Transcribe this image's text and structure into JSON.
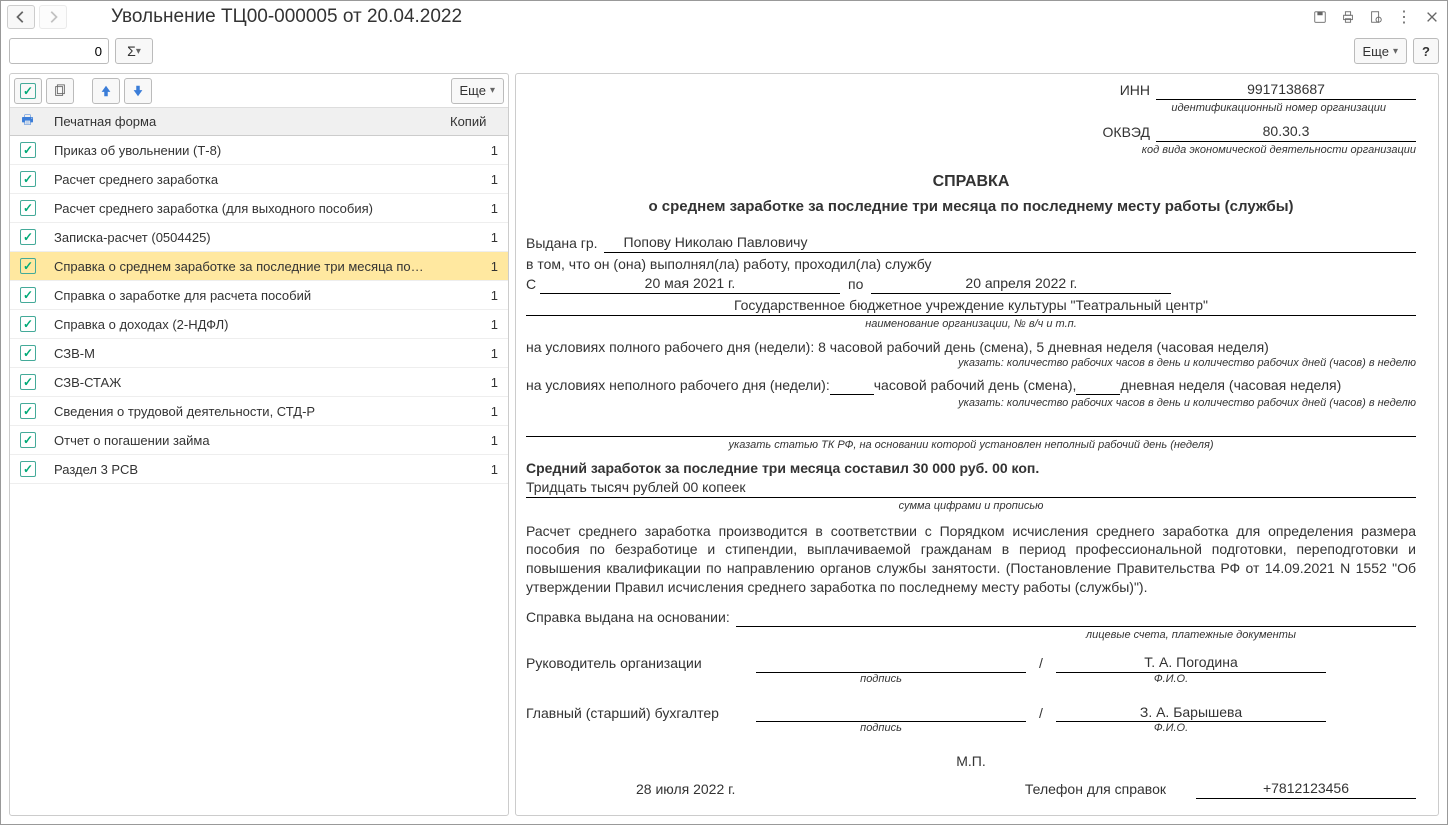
{
  "titlebar": {
    "title": "Увольнение ТЦ00-000005 от 20.04.2022"
  },
  "toolbar": {
    "num_value": "0",
    "more_label": "Еще",
    "help_label": "?"
  },
  "left_toolbar": {
    "more_label": "Еще"
  },
  "list": {
    "header_form": "Печатная форма",
    "header_copies": "Копий",
    "items": [
      {
        "label": "Приказ об увольнении (Т-8)",
        "copies": "1",
        "selected": false
      },
      {
        "label": "Расчет среднего заработка",
        "copies": "1",
        "selected": false
      },
      {
        "label": "Расчет среднего заработка (для выходного пособия)",
        "copies": "1",
        "selected": false
      },
      {
        "label": "Записка-расчет (0504425)",
        "copies": "1",
        "selected": false
      },
      {
        "label": "Справка о среднем заработке за последние три месяца по…",
        "copies": "1",
        "selected": true
      },
      {
        "label": "Справка о заработке для расчета пособий",
        "copies": "1",
        "selected": false
      },
      {
        "label": "Справка о доходах (2-НДФЛ)",
        "copies": "1",
        "selected": false
      },
      {
        "label": "СЗВ-М",
        "copies": "1",
        "selected": false
      },
      {
        "label": "СЗВ-СТАЖ",
        "copies": "1",
        "selected": false
      },
      {
        "label": "Сведения о трудовой деятельности, СТД-Р",
        "copies": "1",
        "selected": false
      },
      {
        "label": "Отчет о погашении займа",
        "copies": "1",
        "selected": false
      },
      {
        "label": "Раздел 3 РСВ",
        "copies": "1",
        "selected": false
      }
    ]
  },
  "doc": {
    "inn_label": "ИНН",
    "inn_val": "9917138687",
    "inn_sub": "идентификационный номер организации",
    "okved_label": "ОКВЭД",
    "okved_val": "80.30.3",
    "okved_sub": "код вида экономической деятельности организации",
    "title": "СПРАВКА",
    "subtitle": "о среднем заработке за последние три месяца по последнему месту работы (службы)",
    "issued_label": "Выдана гр.",
    "issued_name": "Попову Николаю Павловичу",
    "work_text": "в том, что он (она) выполнял(ла) работу, проходил(ла) службу",
    "from_label": "С",
    "from_date": "20 мая 2021 г.",
    "to_label": "по",
    "to_date": "20 апреля 2022 г.",
    "org_name": "Государственное бюджетное учреждение культуры \"Театральный центр\"",
    "org_sub": "наименование организации, № в/ч и т.п.",
    "fulltime_text": "на условиях полного рабочего дня (недели): 8 часовой рабочий день (смена), 5 дневная неделя (часовая неделя)",
    "fulltime_sub": "указать: количество рабочих часов в день и количество рабочих дней (часов) в неделю",
    "parttime_prefix": "на условиях неполного рабочего дня (недели): ",
    "parttime_mid": " часовой рабочий день (смена), ",
    "parttime_suffix": " дневная неделя (часовая неделя)",
    "parttime_sub": "указать: количество рабочих часов в день и количество рабочих дней (часов) в неделю",
    "basis_sub": "указать статью ТК РФ, на основании которой установлен неполный рабочий день (неделя)",
    "avg_title": "Средний заработок за последние три месяца составил 30 000 руб. 00 коп.",
    "avg_words": "Тридцать тысяч рублей 00 копеек",
    "avg_sub": "сумма цифрами и прописью",
    "calc_text": "Расчет среднего заработка производится в соответствии с Порядком исчисления среднего заработка для определения размера пособия по безработице и стипендии, выплачиваемой гражданам в период профессиональной подготовки, переподготовки и повышения квалификации по направлению органов службы занятости. (Постановление Правительства РФ от 14.09.2021 N 1552 \"Об утверждении Правил исчисления среднего заработка по последнему месту работы (службы)\").",
    "basis_label": "Справка выдана на основании:",
    "basis_sub2": "лицевые счета, платежные документы",
    "head_label": "Руководитель организации",
    "head_name": "Т. А. Погодина",
    "acct_label": "Главный (старший) бухгалтер",
    "acct_name": "З. А. Барышева",
    "sign_sub": "подпись",
    "fio_sub": "Ф.И.О.",
    "stamp": "М.П.",
    "date": "28 июля 2022 г.",
    "phone_label": "Телефон для справок",
    "phone_val": "+7812123456"
  }
}
